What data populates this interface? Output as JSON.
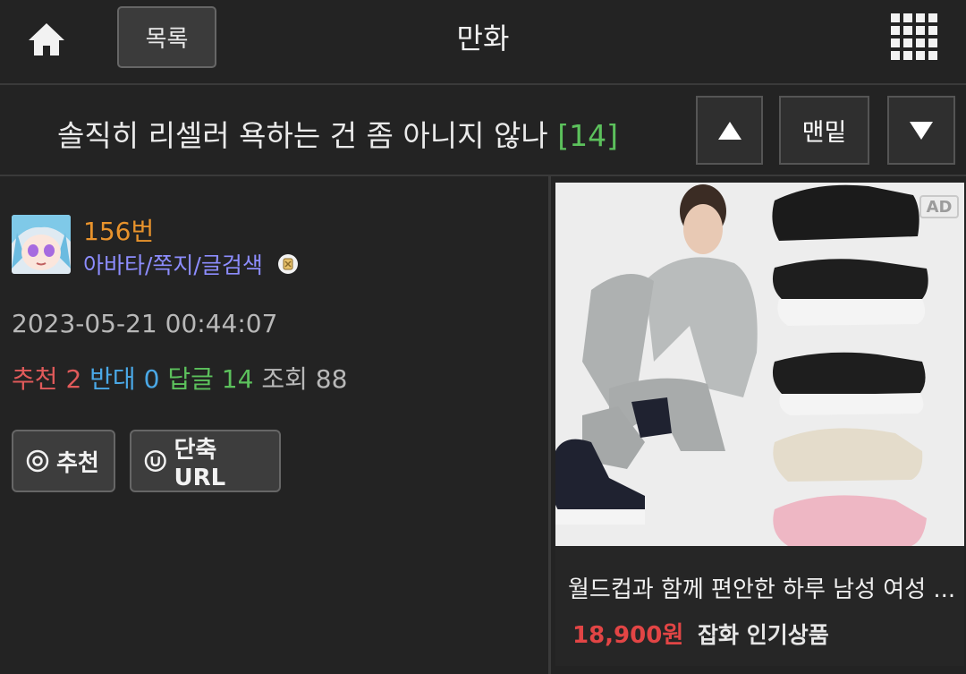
{
  "header": {
    "home_icon": "home-icon",
    "list_label": "목록",
    "title": "만화",
    "grid_icon": "grid-menu-icon"
  },
  "subject": {
    "text": "솔직히 리셀러 욕하는 건 좀 아니지 않나",
    "reply_count": "[14]",
    "up_icon": "arrow-up-icon",
    "bottom_label": "맨밑",
    "down_icon": "arrow-down-icon"
  },
  "post": {
    "number": "156번",
    "author_links": "아바타/쪽지/글검색",
    "date": "2023-05-21 00:44:07",
    "stats": {
      "recommend_label": "추천",
      "recommend_value": "2",
      "oppose_label": "반대",
      "oppose_value": "0",
      "reply_label": "답글",
      "reply_value": "14",
      "view_label": "조회",
      "view_value": "88"
    },
    "actions": {
      "recommend_label": "추천",
      "shorturl_label": "단축URL"
    }
  },
  "ad": {
    "badge": "AD",
    "title": "월드컵과 함께 편안한 하루 남성 여성 ...",
    "price": "18,900원",
    "category": "잡화 인기상품"
  },
  "colors": {
    "background": "#232323",
    "recommend": "#e05a5a",
    "oppose": "#4aa8e6",
    "reply": "#5cc15c",
    "post_number": "#e8932c",
    "author": "#8d8dff",
    "price": "#e24545"
  }
}
